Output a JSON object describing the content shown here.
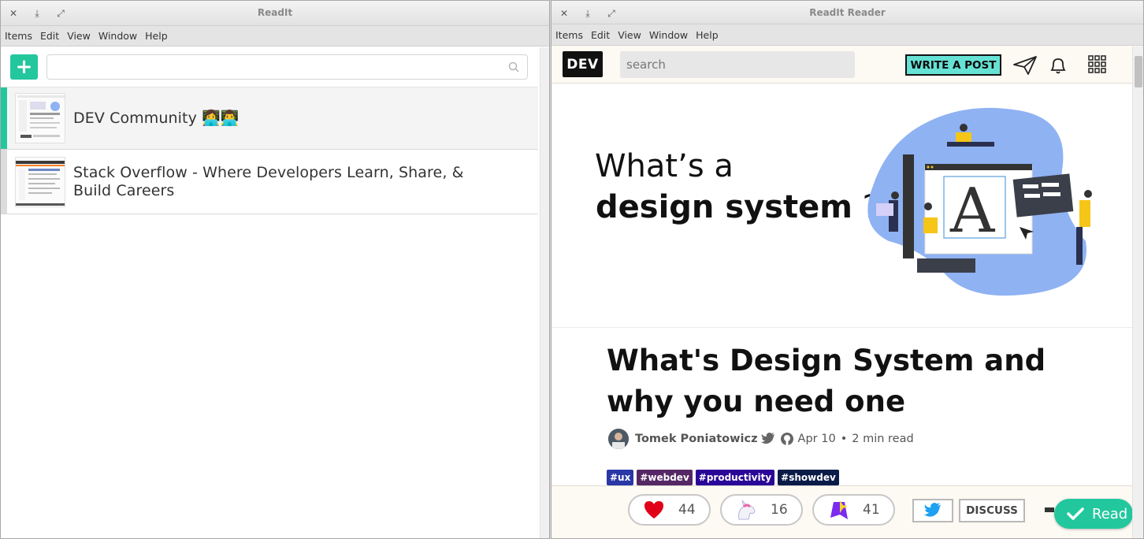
{
  "left_window": {
    "title": "ReadIt",
    "menu": [
      "Items",
      "Edit",
      "View",
      "Window",
      "Help"
    ],
    "add_label": "+",
    "search_placeholder": "",
    "items": [
      {
        "label": "DEV Community 👩‍💻👨‍💻",
        "selected": true
      },
      {
        "label": "Stack Overflow - Where Developers Learn, Share, & Build Careers",
        "selected": false
      }
    ]
  },
  "right_window": {
    "title": "ReadIt Reader",
    "menu": [
      "Items",
      "Edit",
      "View",
      "Window",
      "Help"
    ],
    "dev": {
      "logo": "DEV",
      "search_placeholder": "search",
      "write_label": "WRITE A POST"
    },
    "banner": {
      "line1": "What’s a",
      "line2_bold": "design system",
      "line2_q": " ?"
    },
    "article": {
      "title": "What's Design System and why you need one",
      "author": "Tomek Poniatowicz",
      "date": "Apr 10",
      "read_time": "2 min read",
      "tags": [
        {
          "label": "#ux",
          "color": "#2a37a6"
        },
        {
          "label": "#webdev",
          "color": "#562765"
        },
        {
          "label": "#productivity",
          "color": "#2a0798"
        },
        {
          "label": "#showdev",
          "color": "#091b47"
        }
      ]
    },
    "reactions": {
      "likes": "44",
      "unicorns": "16",
      "bookmarks": "41",
      "discuss_label": "DISCUSS"
    },
    "read_button": "Read"
  },
  "colors": {
    "accent": "#23c79e",
    "dev_write": "#66e2d5"
  }
}
